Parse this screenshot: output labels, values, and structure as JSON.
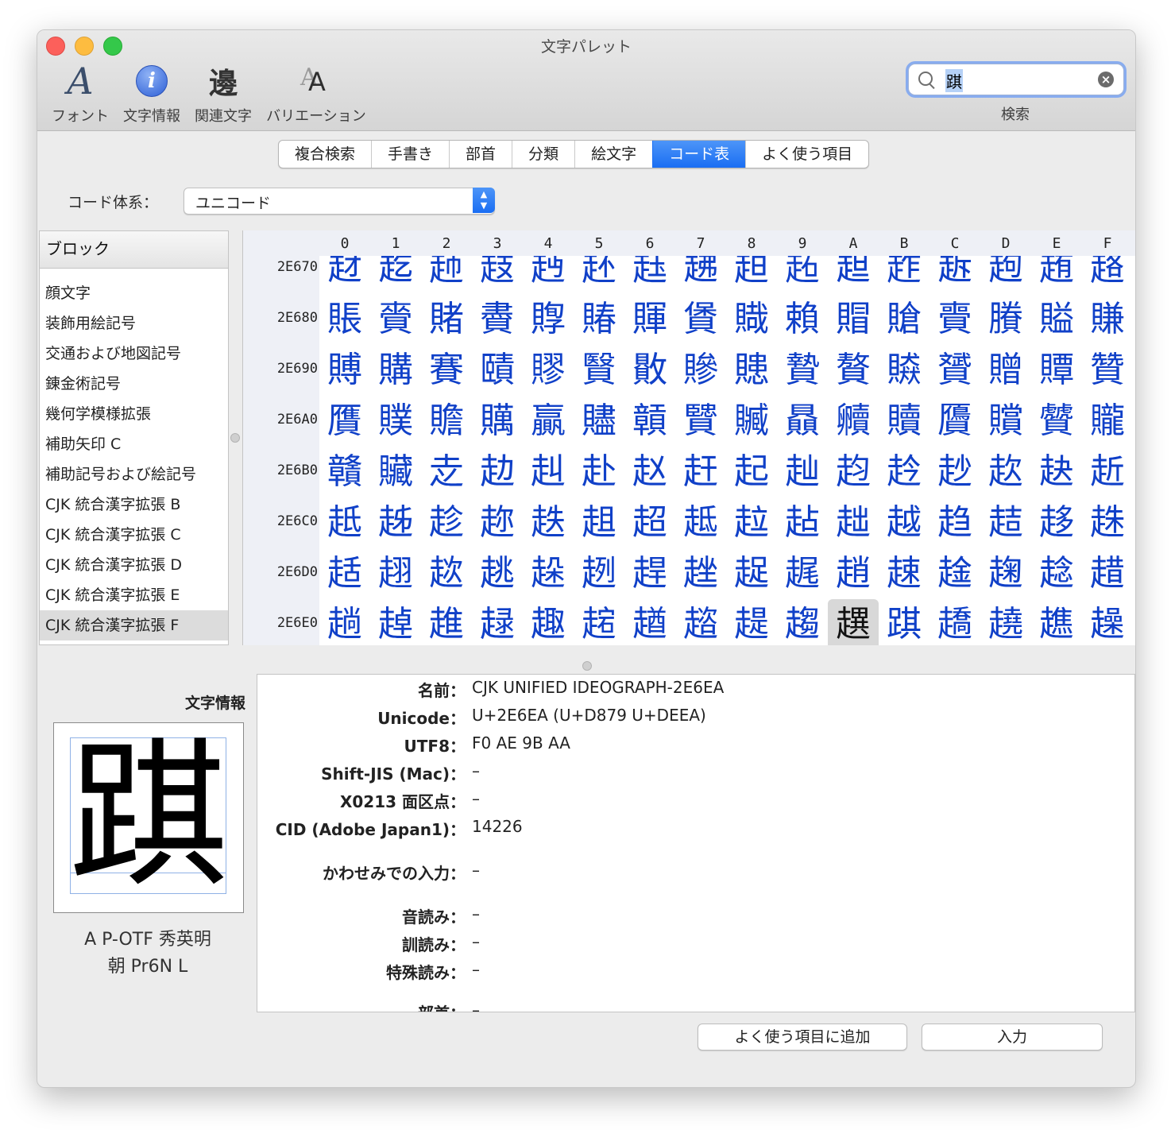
{
  "window": {
    "title": "文字パレット"
  },
  "toolbar": {
    "items": [
      {
        "label": "フォント",
        "glyph": "A"
      },
      {
        "label": "文字情報",
        "glyph": "i"
      },
      {
        "label": "関連文字",
        "glyph": "邊"
      },
      {
        "label": "バリエーション",
        "glyph": "A"
      }
    ],
    "search_value": "踑",
    "search_label": "検索"
  },
  "tabs": [
    "複合検索",
    "手書き",
    "部首",
    "分類",
    "絵文字",
    "コード表",
    "よく使う項目"
  ],
  "active_tab": "コード表",
  "code_system": {
    "label": "コード体系：",
    "value": "ユニコード"
  },
  "blocks": {
    "header": "ブロック",
    "items": [
      "顔文字",
      "装飾用絵記号",
      "交通および地図記号",
      "錬金術記号",
      "幾何学模様拡張",
      "補助矢印 C",
      "補助記号および絵記号",
      "CJK 統合漢字拡張 B",
      "CJK 統合漢字拡張 C",
      "CJK 統合漢字拡張 D",
      "CJK 統合漢字拡張 E",
      "CJK 統合漢字拡張 F"
    ],
    "selected": "CJK 統合漢字拡張 F"
  },
  "grid": {
    "columns": [
      "0",
      "1",
      "2",
      "3",
      "4",
      "5",
      "6",
      "7",
      "8",
      "9",
      "A",
      "B",
      "C",
      "D",
      "E",
      "F"
    ],
    "rows": [
      {
        "label": "2E670",
        "chars": "䞗䞘䞙䞚䞛䞜䞝䞞䞟䞠䞡䞢䞣䞤䞥䞦"
      },
      {
        "label": "2E680",
        "chars": "賬賫賭賮賯賰賱賲賳賴賵賶賷賸賹賺"
      },
      {
        "label": "2E690",
        "chars": "賻購賽賾賿贀贁贂贃贄贅贆贇贈贉贊"
      },
      {
        "label": "2E6A0",
        "chars": "贋贌贍贎贏贐贑贒贓贔贕贖贗贘贙贚"
      },
      {
        "label": "2E6B0",
        "chars": "贛贜赱赲赳赴赵赶起赸赹赺赻赼赽赾"
      },
      {
        "label": "2E6C0",
        "chars": "赿趀趁趂趃趄超趆趇趈趉越趋趌趍趎"
      },
      {
        "label": "2E6D0",
        "chars": "趏趐趑趒趓趔趕趖趗趘趙趚趛趜趝趞"
      },
      {
        "label": "2E6E0",
        "chars": "趟趠趡趢趣趤趥趦趧趨趩踑趫趬趭趮"
      }
    ],
    "selected_row": 7,
    "selected_col": 10
  },
  "char_info": {
    "section_label": "文字情報",
    "glyph": "踑",
    "font_name_line1": "A P-OTF 秀英明",
    "font_name_line2": "朝 Pr6N L",
    "fields": [
      {
        "key": "名前：",
        "value": "CJK UNIFIED IDEOGRAPH-2E6EA"
      },
      {
        "key": "Unicode：",
        "value": "U+2E6EA (U+D879 U+DEEA)"
      },
      {
        "key": "UTF8：",
        "value": "F0 AE 9B AA"
      },
      {
        "key": "Shift-JIS (Mac)：",
        "value": "–"
      },
      {
        "key": "X0213 面区点：",
        "value": "–"
      },
      {
        "key": "CID (Adobe Japan1)：",
        "value": "14226"
      },
      {
        "key": "かわせみでの入力：",
        "value": "–"
      },
      {
        "key": "音読み：",
        "value": "–"
      },
      {
        "key": "訓読み：",
        "value": "–"
      },
      {
        "key": "特殊読み：",
        "value": "–"
      },
      {
        "key": "部首：",
        "value": "–"
      }
    ]
  },
  "buttons": {
    "add_favorite": "よく使う項目に追加",
    "insert": "入力"
  }
}
